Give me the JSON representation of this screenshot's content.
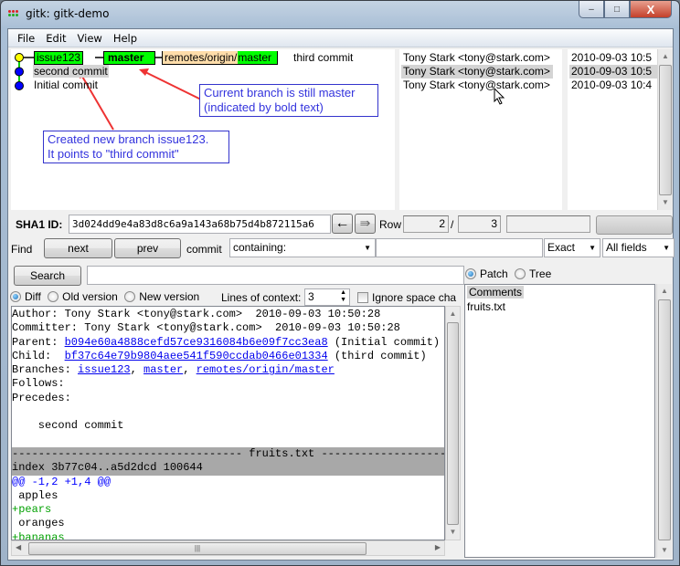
{
  "window": {
    "title": "gitk: gitk-demo",
    "buttons": {
      "minimize": "–",
      "maximize": "□",
      "close": "X"
    }
  },
  "menu": [
    "File",
    "Edit",
    "View",
    "Help"
  ],
  "graph": {
    "commits": [
      {
        "message": "third commit",
        "node_color": "#ffff00",
        "refs": [
          {
            "name": "issue123",
            "bold": false,
            "bg": "#00ff00"
          },
          {
            "name": "master",
            "bold": true,
            "bg": "#00ff00"
          },
          {
            "name_prefix": "remotes/origin/",
            "name": "master",
            "bg_prefix": "#ffddaa",
            "bg": "#00ff00"
          }
        ]
      },
      {
        "message": "second commit",
        "node_color": "#0000ff",
        "selected": true
      },
      {
        "message": "Initial commit",
        "node_color": "#0000ff"
      }
    ],
    "annotations": [
      {
        "lines": [
          "Current branch is still master",
          "(indicated by bold text)"
        ]
      },
      {
        "lines": [
          "Created new branch issue123.",
          "It points to \"third commit\""
        ]
      }
    ]
  },
  "authors": [
    "Tony Stark <tony@stark.com>",
    "Tony Stark <tony@stark.com>",
    "Tony Stark <tony@stark.com>"
  ],
  "dates": [
    "2010-09-03 10:5",
    "2010-09-03 10:5",
    "2010-09-03 10:4"
  ],
  "sha": {
    "label": "SHA1 ID:",
    "value": "3d024dd9e4a83d8c6a9a143a68b75d4b872115a6",
    "back_icon": "←",
    "forward_icon": "⇛",
    "row_label": "Row",
    "row_current": "2",
    "row_sep": "/",
    "row_total": "3"
  },
  "find": {
    "label": "Find",
    "next": "next",
    "prev": "prev",
    "commit_label": "commit",
    "mode": "containing:",
    "query": "",
    "match": "Exact",
    "fields": "All fields"
  },
  "search": {
    "button": "Search",
    "value": ""
  },
  "diff_options": {
    "diff": "Diff",
    "old": "Old version",
    "new": "New version",
    "context_label": "Lines of context:",
    "context_value": "3",
    "ignore_space": "Ignore space cha"
  },
  "file_view": {
    "patch": "Patch",
    "tree": "Tree",
    "files": [
      "Comments",
      "fruits.txt"
    ]
  },
  "details": {
    "author": "Author: Tony Stark <tony@stark.com>  2010-09-03 10:50:28",
    "committer": "Committer: Tony Stark <tony@stark.com>  2010-09-03 10:50:28",
    "parent_label": "Parent: ",
    "parent_sha": "b094e60a4888cefd57ce9316084b6e09f7cc3ea8",
    "parent_note": " (Initial commit)",
    "child_label": "Child:  ",
    "child_sha": "bf37c64e79b9804aee541f590ccdab0466e01334",
    "child_note": " (third commit)",
    "branches_label": "Branches: ",
    "branches": [
      "issue123",
      "master",
      "remotes/origin/master"
    ],
    "follows": "Follows:",
    "precedes": "Precedes:",
    "message": "    second commit",
    "file_header": "----------------------------------- fruits.txt ------------------------------------",
    "index_line": "index 3b77c04..a5d2dcd 100644",
    "hunk": "@@ -1,2 +1,4 @@",
    "lines": [
      {
        "type": "ctx",
        "text": " apples"
      },
      {
        "type": "add",
        "text": "+pears"
      },
      {
        "type": "ctx",
        "text": " oranges"
      },
      {
        "type": "add",
        "text": "+bananas"
      }
    ]
  }
}
